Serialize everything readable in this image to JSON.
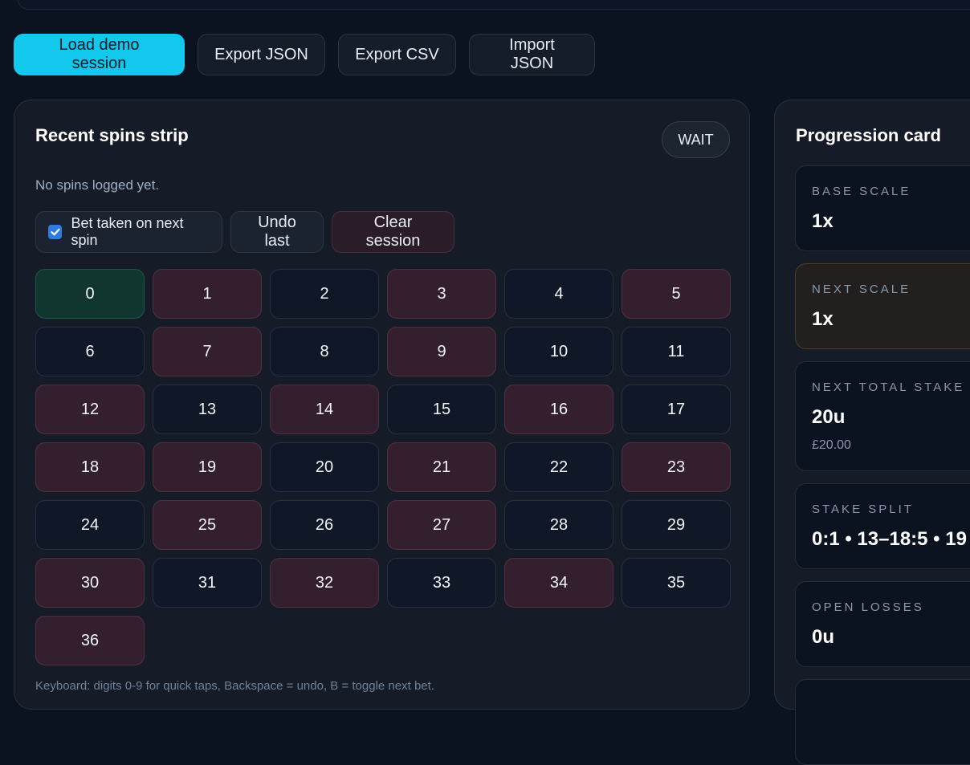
{
  "actions": {
    "load_demo": "Load demo session",
    "export_json": "Export JSON",
    "export_csv": "Export CSV",
    "import_json": "Import JSON"
  },
  "spins": {
    "title": "Recent spins strip",
    "status_badge": "WAIT",
    "empty_text": "No spins logged yet.",
    "bet_toggle_label": "Bet taken on next spin",
    "bet_toggle_checked": true,
    "undo_label": "Undo last",
    "clear_label": "Clear session",
    "numbers": [
      {
        "n": "0",
        "color": "green"
      },
      {
        "n": "1",
        "color": "red"
      },
      {
        "n": "2",
        "color": "black"
      },
      {
        "n": "3",
        "color": "red"
      },
      {
        "n": "4",
        "color": "black"
      },
      {
        "n": "5",
        "color": "red"
      },
      {
        "n": "6",
        "color": "black"
      },
      {
        "n": "7",
        "color": "red"
      },
      {
        "n": "8",
        "color": "black"
      },
      {
        "n": "9",
        "color": "red"
      },
      {
        "n": "10",
        "color": "black"
      },
      {
        "n": "11",
        "color": "black"
      },
      {
        "n": "12",
        "color": "red"
      },
      {
        "n": "13",
        "color": "black"
      },
      {
        "n": "14",
        "color": "red"
      },
      {
        "n": "15",
        "color": "black"
      },
      {
        "n": "16",
        "color": "red"
      },
      {
        "n": "17",
        "color": "black"
      },
      {
        "n": "18",
        "color": "red"
      },
      {
        "n": "19",
        "color": "red"
      },
      {
        "n": "20",
        "color": "black"
      },
      {
        "n": "21",
        "color": "red"
      },
      {
        "n": "22",
        "color": "black"
      },
      {
        "n": "23",
        "color": "red"
      },
      {
        "n": "24",
        "color": "black"
      },
      {
        "n": "25",
        "color": "red"
      },
      {
        "n": "26",
        "color": "black"
      },
      {
        "n": "27",
        "color": "red"
      },
      {
        "n": "28",
        "color": "black"
      },
      {
        "n": "29",
        "color": "black"
      },
      {
        "n": "30",
        "color": "red"
      },
      {
        "n": "31",
        "color": "black"
      },
      {
        "n": "32",
        "color": "red"
      },
      {
        "n": "33",
        "color": "black"
      },
      {
        "n": "34",
        "color": "red"
      },
      {
        "n": "35",
        "color": "black"
      },
      {
        "n": "36",
        "color": "red"
      }
    ],
    "hint": "Keyboard: digits 0-9 for quick taps, Backspace = undo, B = toggle next bet."
  },
  "progression": {
    "title": "Progression card",
    "base_scale_label": "BASE SCALE",
    "base_scale_value": "1x",
    "next_scale_label": "NEXT SCALE",
    "next_scale_value": "1x",
    "next_total_stake_label": "NEXT TOTAL STAKE",
    "next_total_stake_value": "20u",
    "next_total_stake_money": "£20.00",
    "stake_split_label": "STAKE SPLIT",
    "stake_split_value": "0:1 • 13–18:5 • 19",
    "open_losses_label": "OPEN LOSSES",
    "open_losses_value": "0u"
  },
  "colors": {
    "accent": "#12c8ec",
    "background": "#0b1220",
    "red_cell": "#331f2d",
    "black_cell": "#101827",
    "green_cell": "#113630"
  }
}
